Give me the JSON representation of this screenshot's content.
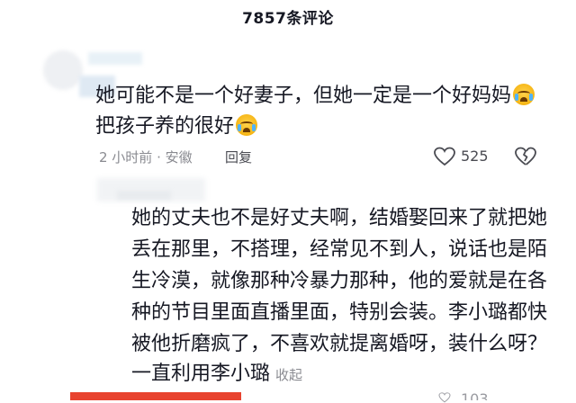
{
  "header": {
    "title": "7857条评论"
  },
  "comments": [
    {
      "line1": "她可能不是一个好妻子，但她一定是一个好妈妈",
      "line2": "把孩子养的很好",
      "time_location": "2 小时前 · 安徽",
      "reply_label": "回复",
      "likes": "525",
      "emoji_icon": "loudly-crying-face-icon"
    },
    {
      "lines": [
        "她的丈夫也不是好丈夫啊，结婚娶回来了就把她",
        "丢在那里，不搭理，经常见不到人，说话也是陌",
        "生冷漠，就像那种冷暴力那种，他的爱就是在各",
        "种的节目里面直播里面，特别会装。李小璐都快",
        "被他折磨疯了，不喜欢就提离婚呀，装什么呀？",
        "一直利用李小璐"
      ],
      "collapse_label": "收起",
      "likes_partial": "103"
    }
  ],
  "colors": {
    "accent_red": "#e8432f",
    "text_primary": "#161823",
    "text_secondary": "#8a8b91"
  }
}
